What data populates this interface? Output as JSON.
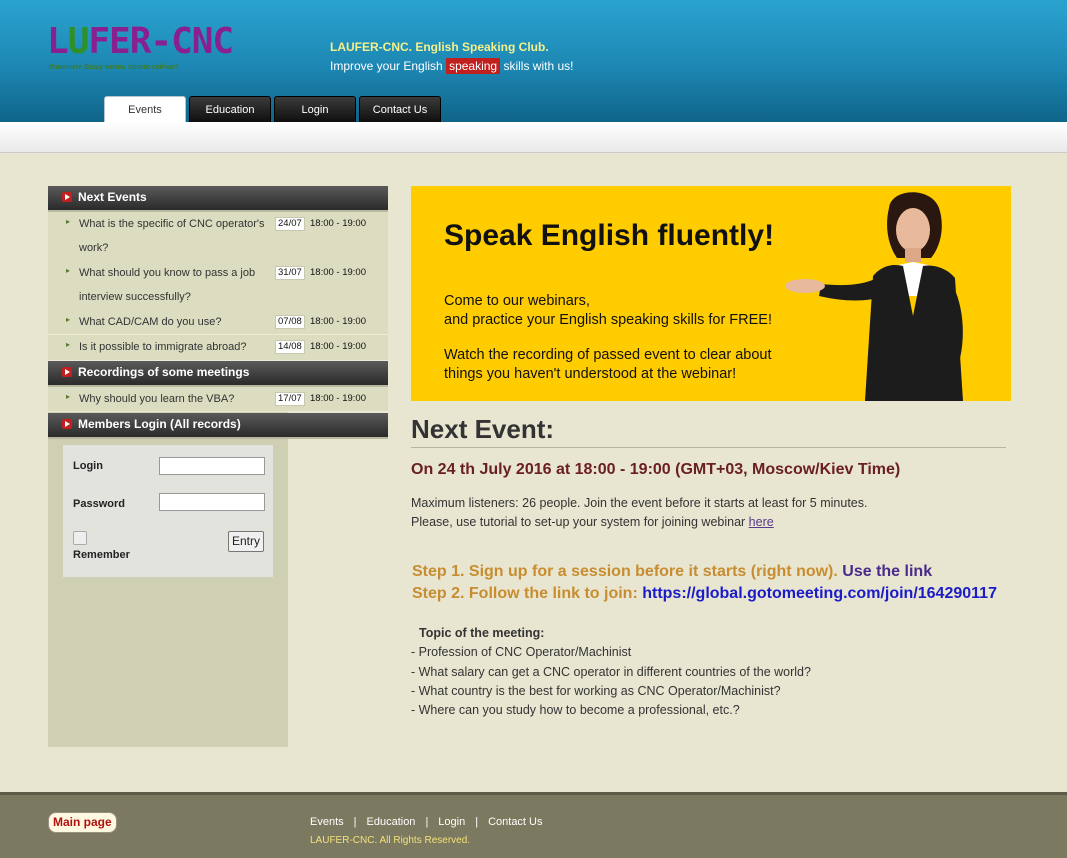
{
  "header": {
    "logo_text_1": "L",
    "logo_text_u": "U",
    "logo_text_2": "FER-CNC",
    "logo_tagline": "Измените Вашу жизнь прямо сейчас!",
    "title": "LAUFER-CNC. English Speaking Club.",
    "sub_before": "Improve your English ",
    "sub_highlight": "speaking",
    "sub_after": " skills with us!"
  },
  "tabs": [
    {
      "label": "Events",
      "active": true
    },
    {
      "label": "Education",
      "active": false
    },
    {
      "label": "Login",
      "active": false
    },
    {
      "label": "Contact Us",
      "active": false
    }
  ],
  "sidebar": {
    "next_events_title": "Next Events",
    "next_events": [
      {
        "title": "What is the specific of CNC operator's work?",
        "date": "24/07",
        "time": "18:00 - 19:00"
      },
      {
        "title": "What should you know to pass a job interview successfully?",
        "date": "31/07",
        "time": "18:00 - 19:00"
      },
      {
        "title": "What CAD/CAM do you use?",
        "date": "07/08",
        "time": "18:00 - 19:00"
      },
      {
        "title": "Is it possible to immigrate abroad?",
        "date": "14/08",
        "time": "18:00 - 19:00"
      }
    ],
    "recordings_title": "Recordings of some meetings",
    "recordings": [
      {
        "title": "Why should you learn the VBA?",
        "date": "17/07",
        "time": "18:00 - 19:00"
      }
    ],
    "login_title": "Members Login (All records)",
    "login": {
      "login_label": "Login",
      "password_label": "Password",
      "remember_label": "Remember",
      "entry_label": "Entry",
      "login_value": "",
      "password_value": ""
    }
  },
  "banner": {
    "headline": "Speak English fluently!",
    "p1_line1": "Come to our webinars,",
    "p1_line2": "and practice your English speaking skills for FREE!",
    "p2_line1": "Watch the recording of passed event to clear about",
    "p2_line2": "things you haven't understood at the webinar!"
  },
  "main": {
    "next_event_title": "Next Event:",
    "date_line": "On 24 th July 2016 at 18:00 - 19:00 (GMT+03, Moscow/Kiev Time)",
    "info_line1": "Maximum listeners: 26 people. Join the event before it starts at least for 5 minutes.",
    "info_line2": "Please, use tutorial to set-up your system for joining webinar ",
    "info_link": "here",
    "step1_text": "Step 1. Sign up for a session before it starts (right now). ",
    "step1_link": "Use the link",
    "step2_text": "Step 2. Follow the link to join: ",
    "step2_link": "https://global.gotomeeting.com/join/164290117",
    "topic_header": "Topic of the meeting:",
    "topics": [
      "- Profession of CNC Operator/Machinist",
      "- What salary can get a CNC operator in different countries of the world?",
      "- What country is the best for working as CNC Operator/Machinist?",
      "- Where can you study how to become a professional, etc.?"
    ]
  },
  "footer": {
    "main_page": "Main page",
    "nav": [
      "Events",
      "Education",
      "Login",
      "Contact Us"
    ],
    "separator": "|",
    "copyright": "LAUFER-CNC. All Rights Reserved."
  },
  "colors": {
    "header_blue": "#1d87b3",
    "banner_yellow": "#ffcc00",
    "highlight_red": "#c0201e",
    "step_orange": "#c78d30"
  }
}
